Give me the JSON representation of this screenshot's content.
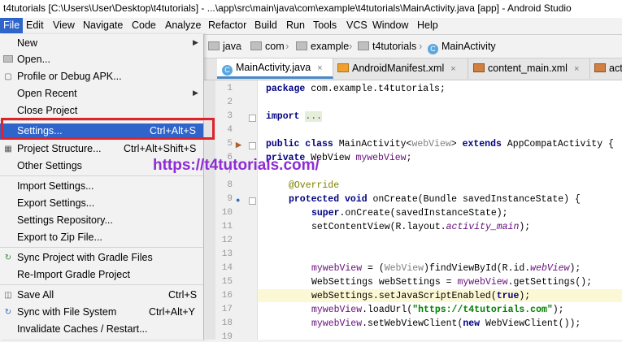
{
  "title": "t4tutorials [C:\\Users\\User\\Desktop\\t4tutorials] - ...\\app\\src\\main\\java\\com\\example\\t4tutorials\\MainActivity.java [app] - Android Studio",
  "menubar": [
    "File",
    "Edit",
    "View",
    "Navigate",
    "Code",
    "Analyze",
    "Refactor",
    "Build",
    "Run",
    "Tools",
    "VCS",
    "Window",
    "Help"
  ],
  "breadcrumb": [
    "java",
    "com",
    "example",
    "t4tutorials",
    "MainActivity"
  ],
  "tabs": [
    {
      "label": "MainActivity.java",
      "close": "×"
    },
    {
      "label": "AndroidManifest.xml",
      "close": "×"
    },
    {
      "label": "content_main.xml",
      "close": "×"
    },
    {
      "label": "activ"
    }
  ],
  "file_menu": {
    "new": "New",
    "open": "Open...",
    "profile": "Profile or Debug APK...",
    "open_recent": "Open Recent",
    "close_project": "Close Project",
    "settings": "Settings...",
    "settings_sc": "Ctrl+Alt+S",
    "project_structure": "Project Structure...",
    "project_structure_sc": "Ctrl+Alt+Shift+S",
    "other_settings": "Other Settings",
    "import_settings": "Import Settings...",
    "export_settings": "Export Settings...",
    "settings_repo": "Settings Repository...",
    "export_zip": "Export to Zip File...",
    "sync_gradle": "Sync Project with Gradle Files",
    "reimport_gradle": "Re-Import Gradle Project",
    "save_all": "Save All",
    "save_all_sc": "Ctrl+S",
    "sync_fs": "Sync with File System",
    "sync_fs_sc": "Ctrl+Alt+Y",
    "invalidate": "Invalidate Caches / Restart..."
  },
  "watermark": "https://t4tutorials.com/",
  "line_numbers": [
    "1",
    "2",
    "3",
    "4",
    "5",
    "6",
    "7",
    "8",
    "9",
    "10",
    "11",
    "12",
    "13",
    "14",
    "15",
    "16",
    "17",
    "18",
    "19"
  ],
  "code": {
    "l1_kw": "package",
    "l1_rest": " com.example.t4tutorials;",
    "l3_kw": "import",
    "l3_dots": "...",
    "l5_kw1": "public class",
    "l5_name": " MainActivity<",
    "l5_gen": "webView",
    "l5_mid": "> ",
    "l5_kw2": "extends",
    "l5_rest": " AppCompatActivity {",
    "l6_kw": "private",
    "l6_type": " WebView ",
    "l6_fld": "mywebView",
    "l6_end": ";",
    "l8_ann": "@Override",
    "l9_kw": "protected void",
    "l9_rest": " onCreate(Bundle savedInstanceState) {",
    "l10_kw": "super",
    "l10_rest": ".onCreate(savedInstanceState);",
    "l11_a": "setContentView(R.layout.",
    "l11_f": "activity_main",
    "l11_b": ");",
    "l14_f": "mywebView",
    "l14_a": " = (",
    "l14_g": "WebView",
    "l14_b": ")findViewById(R.id.",
    "l14_f2": "webView",
    "l14_c": ");",
    "l15_a": "WebSettings webSettings = ",
    "l15_f": "mywebView",
    "l15_b": ".getSettings();",
    "l16_a": "webSettings.setJavaScriptEnabled(",
    "l16_kw": "true",
    "l16_b": ");",
    "l17_f": "mywebView",
    "l17_a": ".loadUrl(",
    "l17_s": "\"https://t4tutorials.com\"",
    "l17_b": ");",
    "l18_f": "mywebView",
    "l18_a": ".setWebViewClient(",
    "l18_kw": "new",
    "l18_b": " WebViewClient());"
  }
}
